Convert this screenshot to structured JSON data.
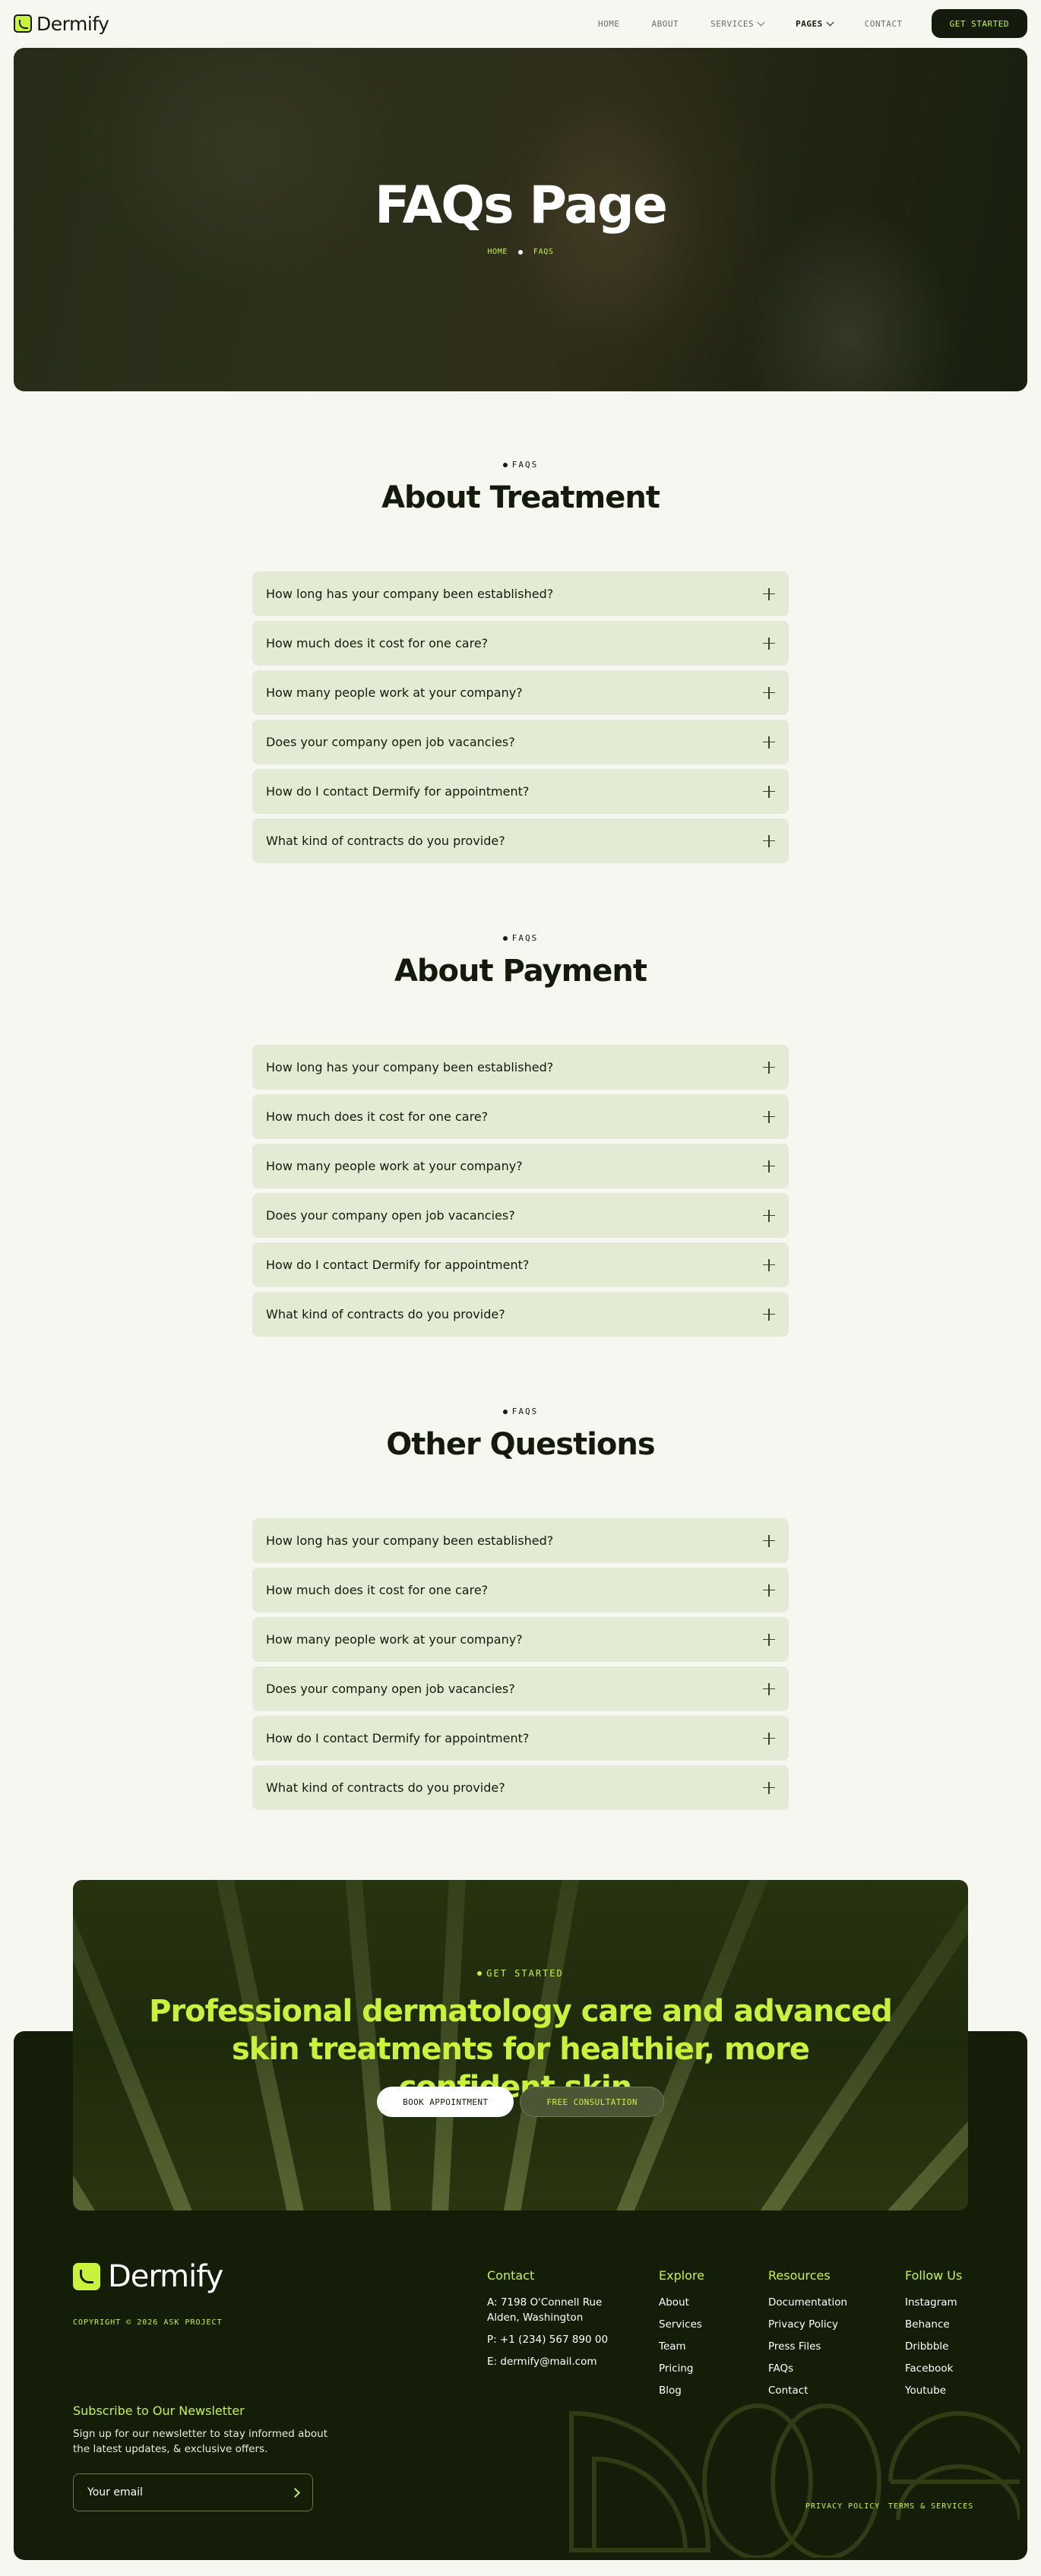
{
  "nav": {
    "brand": "Dermify",
    "links": [
      "HOME",
      "ABOUT",
      "SERVICES",
      "PAGES",
      "CONTACT"
    ],
    "cta": "GET STARTED"
  },
  "hero": {
    "title": "FAQs Page",
    "crumbs": [
      "HOME",
      "FAQS"
    ]
  },
  "sections": [
    {
      "eyebrow": "FAQS",
      "title": "About Treatment",
      "questions": [
        "How long has your company been established?",
        "How much does it cost for one care?",
        "How many people work at your company?",
        "Does your company open job vacancies?",
        "How do I contact Dermify for appointment?",
        "What kind of contracts do you provide?"
      ]
    },
    {
      "eyebrow": "FAQS",
      "title": "About Payment",
      "questions": [
        "How long has your company been established?",
        "How much does it cost for one care?",
        "How many people work at your company?",
        "Does your company open job vacancies?",
        "How do I contact Dermify for appointment?",
        "What kind of contracts do you provide?"
      ]
    },
    {
      "eyebrow": "FAQS",
      "title": "Other Questions",
      "questions": [
        "How long has your company been established?",
        "How much does it cost for one care?",
        "How many people work at your company?",
        "Does your company open job vacancies?",
        "How do I contact Dermify for appointment?",
        "What kind of contracts do you provide?"
      ]
    }
  ],
  "cta": {
    "eyebrow": "GET STARTED",
    "title": "Professional dermatology care and advanced skin treatments for healthier, more confident skin.",
    "primary": "BOOK APPOINTMENT",
    "secondary": "FREE CONSULTATION"
  },
  "footer": {
    "brand": "Dermify",
    "copyright": "COPYRIGHT © 2026 ASK PROJECT",
    "newsletter": {
      "title": "Subscribe to Our Newsletter",
      "text": "Sign up for our newsletter to stay informed about the latest updates, & exclusive offers.",
      "placeholder": "Your email"
    },
    "contact": {
      "title": "Contact",
      "address": "A: 7198 O'Connell Rue Alden, Washington",
      "phone": "P: +1 (234) 567 890 00",
      "email": "E: dermify@mail.com"
    },
    "explore": {
      "title": "Explore",
      "items": [
        "About",
        "Services",
        "Team",
        "Pricing",
        "Blog"
      ]
    },
    "resources": {
      "title": "Resources",
      "items": [
        "Documentation",
        "Privacy Policy",
        "Press Files",
        "FAQs",
        "Contact"
      ]
    },
    "follow": {
      "title": "Follow Us",
      "items": [
        "Instagram",
        "Behance",
        "Dribbble",
        "Facebook",
        "Youtube"
      ]
    },
    "legal": [
      "PRIVACY POLICY",
      "TERMS & SERVICES"
    ]
  },
  "colors": {
    "accent": "#c8f33a",
    "dark": "#141d08",
    "faq_bg": "#e3ebd5",
    "page_bg": "#f6f7f1"
  }
}
